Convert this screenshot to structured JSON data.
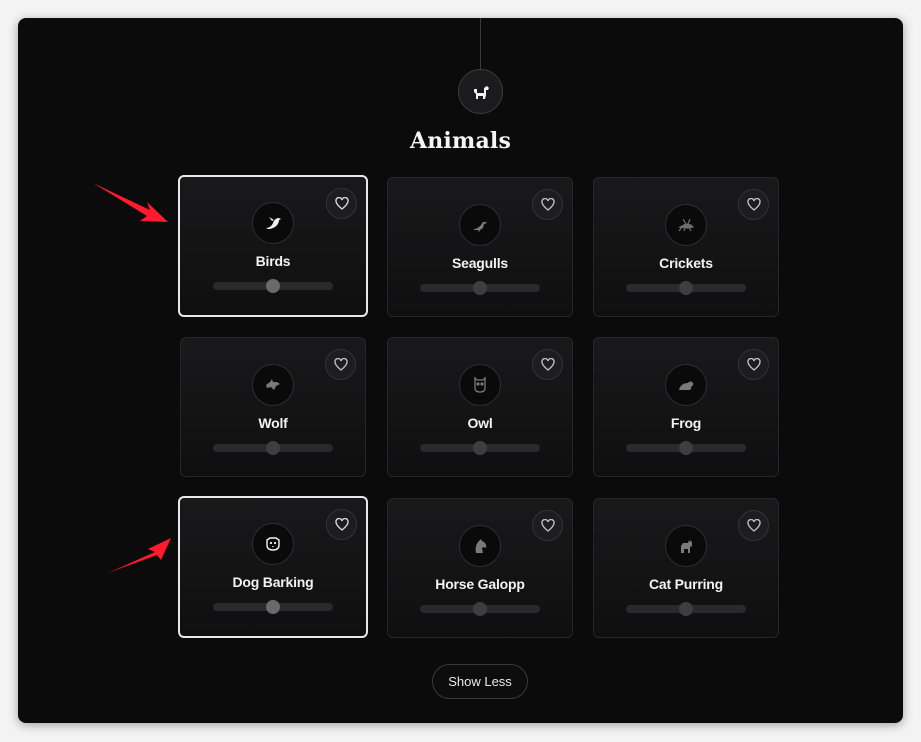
{
  "category": {
    "title": "Animals",
    "icon": "dog-icon"
  },
  "sounds": [
    {
      "label": "Birds",
      "icon": "bird-icon",
      "active": true,
      "volume": 0.5
    },
    {
      "label": "Seagulls",
      "icon": "seagull-icon",
      "active": false,
      "volume": 0.5
    },
    {
      "label": "Crickets",
      "icon": "cricket-icon",
      "active": false,
      "volume": 0.5
    },
    {
      "label": "Wolf",
      "icon": "wolf-icon",
      "active": false,
      "volume": 0.5
    },
    {
      "label": "Owl",
      "icon": "owl-icon",
      "active": false,
      "volume": 0.5
    },
    {
      "label": "Frog",
      "icon": "frog-icon",
      "active": false,
      "volume": 0.5
    },
    {
      "label": "Dog Barking",
      "icon": "dog-face-icon",
      "active": true,
      "volume": 0.5
    },
    {
      "label": "Horse Galopp",
      "icon": "horse-icon",
      "active": false,
      "volume": 0.5
    },
    {
      "label": "Cat Purring",
      "icon": "cat-icon",
      "active": false,
      "volume": 0.5
    }
  ],
  "show_less_label": "Show Less",
  "colors": {
    "background": "#0b0b0c",
    "active_border": "#e8e8e8",
    "annotation_arrow": "#ff1a2e"
  }
}
